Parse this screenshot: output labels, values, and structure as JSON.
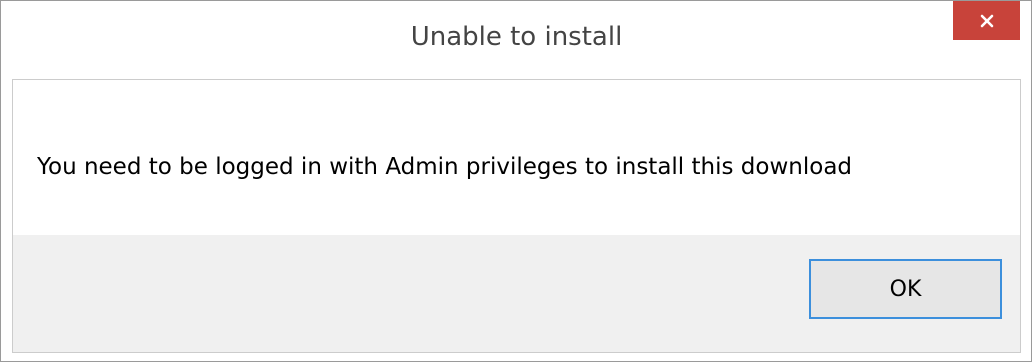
{
  "window": {
    "title": "Unable to install",
    "close_icon": "close-icon",
    "close_color": "#c8433a"
  },
  "body": {
    "message": "You need to be logged in with Admin privileges to install this download"
  },
  "footer": {
    "ok_label": "OK",
    "ok_border_color": "#3c8fdc"
  }
}
